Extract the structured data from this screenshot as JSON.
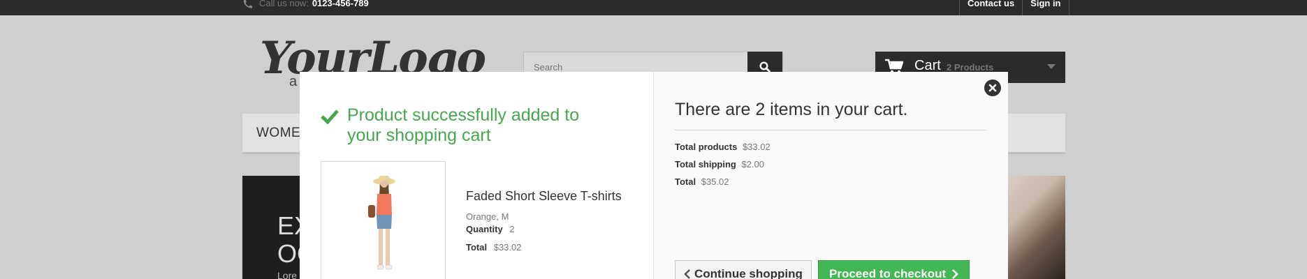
{
  "topbar": {
    "call_label": "Call us now:",
    "phone": "0123-456-789",
    "links": [
      "Contact us",
      "Sign in"
    ]
  },
  "header": {
    "logo_text": "YourLogo",
    "logo_sub": "a",
    "search_placeholder": "Search",
    "cart_label": "Cart",
    "cart_count": "2 Products"
  },
  "menu": {
    "first_item": "WOMEN"
  },
  "banner": {
    "title": "EXCEPTIONAL OC",
    "text": "Lore"
  },
  "modal": {
    "success_message": "Product successfully added to your shopping cart",
    "product": {
      "name": "Faded Short Sleeve T-shirts",
      "attributes": "Orange, M",
      "quantity_label": "Quantity",
      "quantity": "2",
      "total_label": "Total",
      "total": "$33.02"
    },
    "cart_heading": "There are 2 items in your cart.",
    "summary": {
      "products_label": "Total products",
      "products_value": "$33.02",
      "shipping_label": "Total shipping",
      "shipping_value": "$2.00",
      "total_label": "Total",
      "total_value": "$35.02"
    },
    "continue_label": "Continue shopping",
    "checkout_label": "Proceed to checkout"
  },
  "colors": {
    "success_green": "#46a74e",
    "checkout_button": "#43b754",
    "topbar": "#2b2b2b"
  },
  "icons": [
    "phone-icon",
    "search-icon",
    "cart-icon",
    "check-icon",
    "close-icon",
    "chevron-left-icon",
    "chevron-right-icon"
  ]
}
